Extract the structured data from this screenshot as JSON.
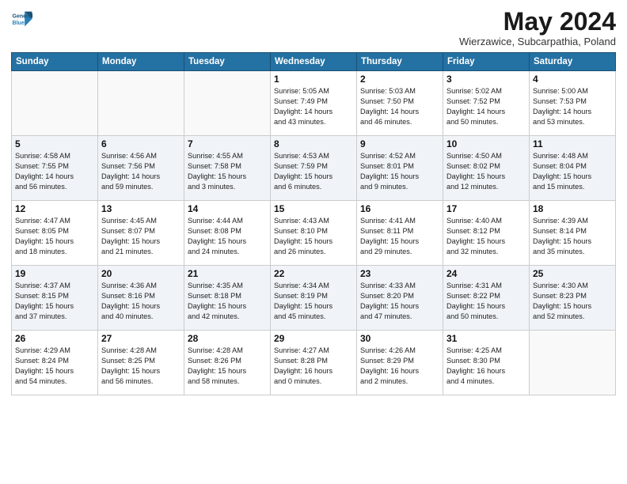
{
  "header": {
    "logo_line1": "General",
    "logo_line2": "Blue",
    "month": "May 2024",
    "location": "Wierzawice, Subcarpathia, Poland"
  },
  "days_of_week": [
    "Sunday",
    "Monday",
    "Tuesday",
    "Wednesday",
    "Thursday",
    "Friday",
    "Saturday"
  ],
  "weeks": [
    [
      {
        "day": "",
        "text": ""
      },
      {
        "day": "",
        "text": ""
      },
      {
        "day": "",
        "text": ""
      },
      {
        "day": "1",
        "text": "Sunrise: 5:05 AM\nSunset: 7:49 PM\nDaylight: 14 hours\nand 43 minutes."
      },
      {
        "day": "2",
        "text": "Sunrise: 5:03 AM\nSunset: 7:50 PM\nDaylight: 14 hours\nand 46 minutes."
      },
      {
        "day": "3",
        "text": "Sunrise: 5:02 AM\nSunset: 7:52 PM\nDaylight: 14 hours\nand 50 minutes."
      },
      {
        "day": "4",
        "text": "Sunrise: 5:00 AM\nSunset: 7:53 PM\nDaylight: 14 hours\nand 53 minutes."
      }
    ],
    [
      {
        "day": "5",
        "text": "Sunrise: 4:58 AM\nSunset: 7:55 PM\nDaylight: 14 hours\nand 56 minutes."
      },
      {
        "day": "6",
        "text": "Sunrise: 4:56 AM\nSunset: 7:56 PM\nDaylight: 14 hours\nand 59 minutes."
      },
      {
        "day": "7",
        "text": "Sunrise: 4:55 AM\nSunset: 7:58 PM\nDaylight: 15 hours\nand 3 minutes."
      },
      {
        "day": "8",
        "text": "Sunrise: 4:53 AM\nSunset: 7:59 PM\nDaylight: 15 hours\nand 6 minutes."
      },
      {
        "day": "9",
        "text": "Sunrise: 4:52 AM\nSunset: 8:01 PM\nDaylight: 15 hours\nand 9 minutes."
      },
      {
        "day": "10",
        "text": "Sunrise: 4:50 AM\nSunset: 8:02 PM\nDaylight: 15 hours\nand 12 minutes."
      },
      {
        "day": "11",
        "text": "Sunrise: 4:48 AM\nSunset: 8:04 PM\nDaylight: 15 hours\nand 15 minutes."
      }
    ],
    [
      {
        "day": "12",
        "text": "Sunrise: 4:47 AM\nSunset: 8:05 PM\nDaylight: 15 hours\nand 18 minutes."
      },
      {
        "day": "13",
        "text": "Sunrise: 4:45 AM\nSunset: 8:07 PM\nDaylight: 15 hours\nand 21 minutes."
      },
      {
        "day": "14",
        "text": "Sunrise: 4:44 AM\nSunset: 8:08 PM\nDaylight: 15 hours\nand 24 minutes."
      },
      {
        "day": "15",
        "text": "Sunrise: 4:43 AM\nSunset: 8:10 PM\nDaylight: 15 hours\nand 26 minutes."
      },
      {
        "day": "16",
        "text": "Sunrise: 4:41 AM\nSunset: 8:11 PM\nDaylight: 15 hours\nand 29 minutes."
      },
      {
        "day": "17",
        "text": "Sunrise: 4:40 AM\nSunset: 8:12 PM\nDaylight: 15 hours\nand 32 minutes."
      },
      {
        "day": "18",
        "text": "Sunrise: 4:39 AM\nSunset: 8:14 PM\nDaylight: 15 hours\nand 35 minutes."
      }
    ],
    [
      {
        "day": "19",
        "text": "Sunrise: 4:37 AM\nSunset: 8:15 PM\nDaylight: 15 hours\nand 37 minutes."
      },
      {
        "day": "20",
        "text": "Sunrise: 4:36 AM\nSunset: 8:16 PM\nDaylight: 15 hours\nand 40 minutes."
      },
      {
        "day": "21",
        "text": "Sunrise: 4:35 AM\nSunset: 8:18 PM\nDaylight: 15 hours\nand 42 minutes."
      },
      {
        "day": "22",
        "text": "Sunrise: 4:34 AM\nSunset: 8:19 PM\nDaylight: 15 hours\nand 45 minutes."
      },
      {
        "day": "23",
        "text": "Sunrise: 4:33 AM\nSunset: 8:20 PM\nDaylight: 15 hours\nand 47 minutes."
      },
      {
        "day": "24",
        "text": "Sunrise: 4:31 AM\nSunset: 8:22 PM\nDaylight: 15 hours\nand 50 minutes."
      },
      {
        "day": "25",
        "text": "Sunrise: 4:30 AM\nSunset: 8:23 PM\nDaylight: 15 hours\nand 52 minutes."
      }
    ],
    [
      {
        "day": "26",
        "text": "Sunrise: 4:29 AM\nSunset: 8:24 PM\nDaylight: 15 hours\nand 54 minutes."
      },
      {
        "day": "27",
        "text": "Sunrise: 4:28 AM\nSunset: 8:25 PM\nDaylight: 15 hours\nand 56 minutes."
      },
      {
        "day": "28",
        "text": "Sunrise: 4:28 AM\nSunset: 8:26 PM\nDaylight: 15 hours\nand 58 minutes."
      },
      {
        "day": "29",
        "text": "Sunrise: 4:27 AM\nSunset: 8:28 PM\nDaylight: 16 hours\nand 0 minutes."
      },
      {
        "day": "30",
        "text": "Sunrise: 4:26 AM\nSunset: 8:29 PM\nDaylight: 16 hours\nand 2 minutes."
      },
      {
        "day": "31",
        "text": "Sunrise: 4:25 AM\nSunset: 8:30 PM\nDaylight: 16 hours\nand 4 minutes."
      },
      {
        "day": "",
        "text": ""
      }
    ]
  ]
}
